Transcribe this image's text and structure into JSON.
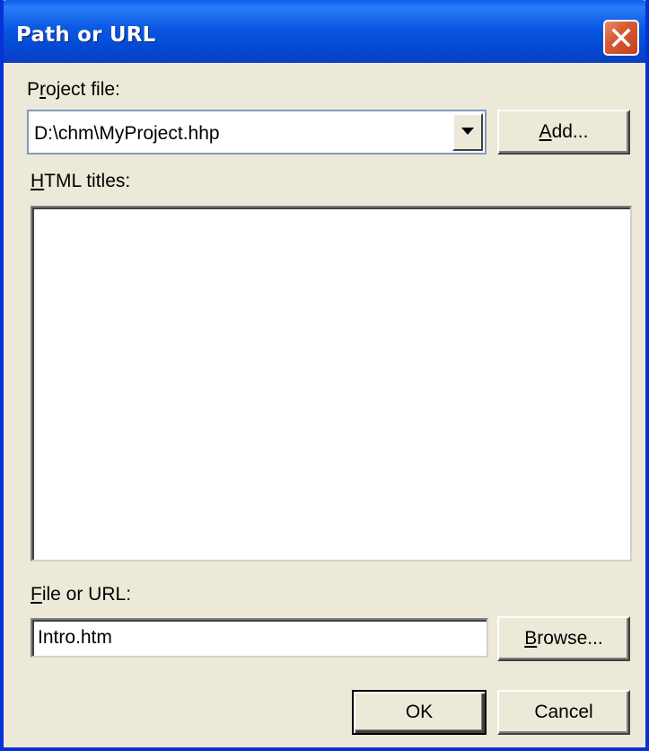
{
  "window": {
    "title": "Path or URL",
    "title_color": "#ffffff",
    "titlebar_color": "#0a58e3",
    "close_button_color": "#d65b35"
  },
  "project_file": {
    "label_prefix": "P",
    "label_mnemonic": "r",
    "label_suffix": "oject file:",
    "value": "D:\\chm\\MyProject.hhp",
    "add_button": {
      "mnemonic": "A",
      "rest": "dd..."
    }
  },
  "html_titles": {
    "label_mnemonic": "H",
    "label_rest": "TML titles:",
    "items": []
  },
  "file_or_url": {
    "label_mnemonic": "F",
    "label_rest": "ile or URL:",
    "value": "Intro.htm",
    "browse_button": {
      "mnemonic": "B",
      "rest": "rowse..."
    }
  },
  "footer": {
    "ok_label": "OK",
    "cancel_label": "Cancel"
  }
}
